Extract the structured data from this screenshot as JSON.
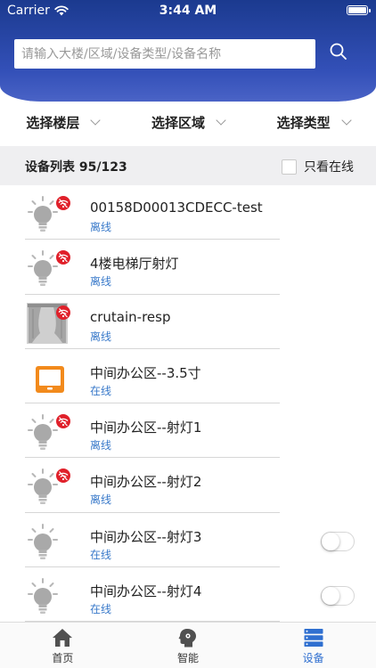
{
  "status_bar": {
    "carrier": "Carrier",
    "time": "3:44 AM"
  },
  "search": {
    "placeholder": "请输入大楼/区域/设备类型/设备名称",
    "value": ""
  },
  "filters": [
    {
      "label": "选择楼层"
    },
    {
      "label": "选择区域"
    },
    {
      "label": "选择类型"
    }
  ],
  "list_header": {
    "title": "设备列表 95/123",
    "online_only_label": "只看在线"
  },
  "devices": [
    {
      "name": "00158D00013CDECC-test",
      "status": "离线",
      "icon": "light-bulb-icon",
      "offline_badge": true,
      "has_toggle": false
    },
    {
      "name": "4楼电梯厅射灯",
      "status": "离线",
      "icon": "light-bulb-icon",
      "offline_badge": true,
      "has_toggle": false
    },
    {
      "name": "crutain-resp",
      "status": "离线",
      "icon": "curtain-icon",
      "offline_badge": true,
      "has_toggle": false
    },
    {
      "name": "中间办公区--3.5寸",
      "status": "在线",
      "icon": "panel-screen-icon",
      "offline_badge": false,
      "has_toggle": false
    },
    {
      "name": "中间办公区--射灯1",
      "status": "离线",
      "icon": "light-bulb-icon",
      "offline_badge": true,
      "has_toggle": false
    },
    {
      "name": "中间办公区--射灯2",
      "status": "离线",
      "icon": "light-bulb-icon",
      "offline_badge": true,
      "has_toggle": false
    },
    {
      "name": "中间办公区--射灯3",
      "status": "在线",
      "icon": "light-bulb-icon",
      "offline_badge": false,
      "has_toggle": true
    },
    {
      "name": "中间办公区--射灯4",
      "status": "在线",
      "icon": "light-bulb-icon",
      "offline_badge": false,
      "has_toggle": true
    }
  ],
  "tabs": [
    {
      "label": "首页",
      "icon": "home-icon",
      "active": false
    },
    {
      "label": "智能",
      "icon": "smart-head-icon",
      "active": false
    },
    {
      "label": "设备",
      "icon": "device-list-icon",
      "active": true
    }
  ],
  "colors": {
    "header": "#2b47a8",
    "status_text": "#3778c9",
    "offline_badge": "#e0202a",
    "active_tab": "#2f6fd0"
  }
}
